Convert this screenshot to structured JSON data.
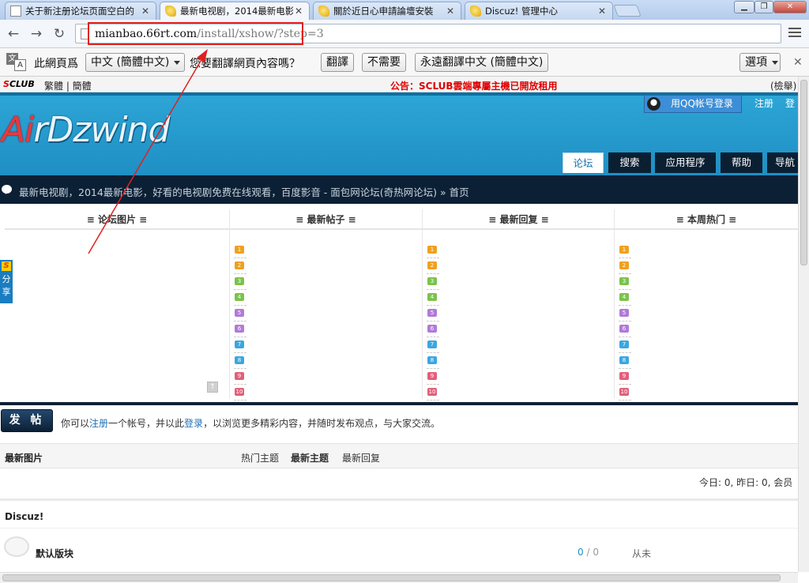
{
  "tabs": [
    {
      "title": "关于新注册论坛页面空白的",
      "icon": "doc-icon",
      "active": false
    },
    {
      "title": "最新电视剧，2014最新电影",
      "icon": "discuz-icon",
      "active": true
    },
    {
      "title": "關於近日心申請論壇安裝",
      "icon": "discuz-icon",
      "active": false
    },
    {
      "title": "Discuz! 管理中心",
      "icon": "discuz-icon",
      "active": false
    }
  ],
  "toolbar": {
    "url_domain": "mianbao.66rt.com",
    "url_path": "/install/xshow/?step=3",
    "highlight_color": "#e02020"
  },
  "translate": {
    "prompt": "此網頁爲",
    "language": "中文 (簡體中文)",
    "question": "您要翻譯網頁內容嗎？",
    "translate_btn": "翻譯",
    "no_btn": "不需要",
    "always_btn": "永遠翻譯中文 (簡體中文)",
    "options_btn": "選項",
    "icon_a": "文",
    "icon_b": "A"
  },
  "site": {
    "sclub_logo_s": "S",
    "sclub_logo_rest": "CLUB",
    "lang_links": "繁體 | 簡體",
    "announcement": "公告：SCLUB雲端專屬主機已開放租用",
    "report": "(檢舉)",
    "logo_red": "Ai",
    "logo_rest": "rDzwind",
    "qq_login": "用QQ帐号登录",
    "register": "注册",
    "login": "登",
    "nav": [
      "论坛",
      "搜索",
      "应用程序",
      "帮助",
      "导航"
    ],
    "breadcrumb": "最新电视剧，2014最新电影，好看的电视剧免费在线观看，百度影音 - 面包网论坛(奇热网论坛) » 首页",
    "share_badge": "S",
    "share_label": "分享"
  },
  "portal": {
    "columns": [
      "≡ 论坛图片 ≡",
      "≡ 最新帖子 ≡",
      "≡ 最新回复 ≡",
      "≡ 本周热门 ≡"
    ],
    "rank_numbers": [
      "1",
      "2",
      "3",
      "4",
      "5",
      "6",
      "7",
      "8",
      "9",
      "10"
    ],
    "rank_colors": [
      "#f0a020",
      "#f0a020",
      "#7cc24a",
      "#7cc24a",
      "#b27ad8",
      "#b27ad8",
      "#3aa7e0",
      "#3aa7e0",
      "#e0607a",
      "#e0607a"
    ],
    "slider_label": "↑"
  },
  "post": {
    "button": "发 帖",
    "hint_prefix": "你可以",
    "hint_register": "注册",
    "hint_middle": "一个帐号，并以此",
    "hint_login": "登录",
    "hint_suffix": "，以浏览更多精彩内容，并随时发布观点，与大家交流。"
  },
  "latest": {
    "title": "最新图片",
    "tabs": [
      "热门主题",
      "最新主题",
      "最新回复"
    ],
    "stats": "今日: 0, 昨日: 0, 会员"
  },
  "forum": {
    "category": "Discuz!",
    "name": "默认版块",
    "count_new": "0",
    "count_sep": " / ",
    "count_total": "0",
    "last": "从未"
  }
}
